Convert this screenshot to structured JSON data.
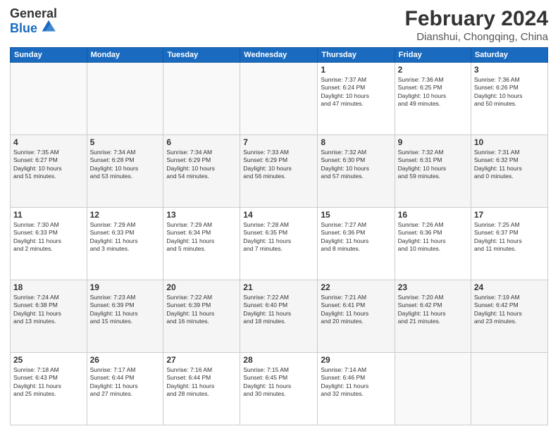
{
  "header": {
    "logo_general": "General",
    "logo_blue": "Blue",
    "month_title": "February 2024",
    "location": "Dianshui, Chongqing, China"
  },
  "weekdays": [
    "Sunday",
    "Monday",
    "Tuesday",
    "Wednesday",
    "Thursday",
    "Friday",
    "Saturday"
  ],
  "weeks": [
    [
      {
        "day": "",
        "info": ""
      },
      {
        "day": "",
        "info": ""
      },
      {
        "day": "",
        "info": ""
      },
      {
        "day": "",
        "info": ""
      },
      {
        "day": "1",
        "info": "Sunrise: 7:37 AM\nSunset: 6:24 PM\nDaylight: 10 hours\nand 47 minutes."
      },
      {
        "day": "2",
        "info": "Sunrise: 7:36 AM\nSunset: 6:25 PM\nDaylight: 10 hours\nand 49 minutes."
      },
      {
        "day": "3",
        "info": "Sunrise: 7:36 AM\nSunset: 6:26 PM\nDaylight: 10 hours\nand 50 minutes."
      }
    ],
    [
      {
        "day": "4",
        "info": "Sunrise: 7:35 AM\nSunset: 6:27 PM\nDaylight: 10 hours\nand 51 minutes."
      },
      {
        "day": "5",
        "info": "Sunrise: 7:34 AM\nSunset: 6:28 PM\nDaylight: 10 hours\nand 53 minutes."
      },
      {
        "day": "6",
        "info": "Sunrise: 7:34 AM\nSunset: 6:29 PM\nDaylight: 10 hours\nand 54 minutes."
      },
      {
        "day": "7",
        "info": "Sunrise: 7:33 AM\nSunset: 6:29 PM\nDaylight: 10 hours\nand 56 minutes."
      },
      {
        "day": "8",
        "info": "Sunrise: 7:32 AM\nSunset: 6:30 PM\nDaylight: 10 hours\nand 57 minutes."
      },
      {
        "day": "9",
        "info": "Sunrise: 7:32 AM\nSunset: 6:31 PM\nDaylight: 10 hours\nand 59 minutes."
      },
      {
        "day": "10",
        "info": "Sunrise: 7:31 AM\nSunset: 6:32 PM\nDaylight: 11 hours\nand 0 minutes."
      }
    ],
    [
      {
        "day": "11",
        "info": "Sunrise: 7:30 AM\nSunset: 6:33 PM\nDaylight: 11 hours\nand 2 minutes."
      },
      {
        "day": "12",
        "info": "Sunrise: 7:29 AM\nSunset: 6:33 PM\nDaylight: 11 hours\nand 3 minutes."
      },
      {
        "day": "13",
        "info": "Sunrise: 7:29 AM\nSunset: 6:34 PM\nDaylight: 11 hours\nand 5 minutes."
      },
      {
        "day": "14",
        "info": "Sunrise: 7:28 AM\nSunset: 6:35 PM\nDaylight: 11 hours\nand 7 minutes."
      },
      {
        "day": "15",
        "info": "Sunrise: 7:27 AM\nSunset: 6:36 PM\nDaylight: 11 hours\nand 8 minutes."
      },
      {
        "day": "16",
        "info": "Sunrise: 7:26 AM\nSunset: 6:36 PM\nDaylight: 11 hours\nand 10 minutes."
      },
      {
        "day": "17",
        "info": "Sunrise: 7:25 AM\nSunset: 6:37 PM\nDaylight: 11 hours\nand 11 minutes."
      }
    ],
    [
      {
        "day": "18",
        "info": "Sunrise: 7:24 AM\nSunset: 6:38 PM\nDaylight: 11 hours\nand 13 minutes."
      },
      {
        "day": "19",
        "info": "Sunrise: 7:23 AM\nSunset: 6:39 PM\nDaylight: 11 hours\nand 15 minutes."
      },
      {
        "day": "20",
        "info": "Sunrise: 7:22 AM\nSunset: 6:39 PM\nDaylight: 11 hours\nand 16 minutes."
      },
      {
        "day": "21",
        "info": "Sunrise: 7:22 AM\nSunset: 6:40 PM\nDaylight: 11 hours\nand 18 minutes."
      },
      {
        "day": "22",
        "info": "Sunrise: 7:21 AM\nSunset: 6:41 PM\nDaylight: 11 hours\nand 20 minutes."
      },
      {
        "day": "23",
        "info": "Sunrise: 7:20 AM\nSunset: 6:42 PM\nDaylight: 11 hours\nand 21 minutes."
      },
      {
        "day": "24",
        "info": "Sunrise: 7:19 AM\nSunset: 6:42 PM\nDaylight: 11 hours\nand 23 minutes."
      }
    ],
    [
      {
        "day": "25",
        "info": "Sunrise: 7:18 AM\nSunset: 6:43 PM\nDaylight: 11 hours\nand 25 minutes."
      },
      {
        "day": "26",
        "info": "Sunrise: 7:17 AM\nSunset: 6:44 PM\nDaylight: 11 hours\nand 27 minutes."
      },
      {
        "day": "27",
        "info": "Sunrise: 7:16 AM\nSunset: 6:44 PM\nDaylight: 11 hours\nand 28 minutes."
      },
      {
        "day": "28",
        "info": "Sunrise: 7:15 AM\nSunset: 6:45 PM\nDaylight: 11 hours\nand 30 minutes."
      },
      {
        "day": "29",
        "info": "Sunrise: 7:14 AM\nSunset: 6:46 PM\nDaylight: 11 hours\nand 32 minutes."
      },
      {
        "day": "",
        "info": ""
      },
      {
        "day": "",
        "info": ""
      }
    ]
  ]
}
